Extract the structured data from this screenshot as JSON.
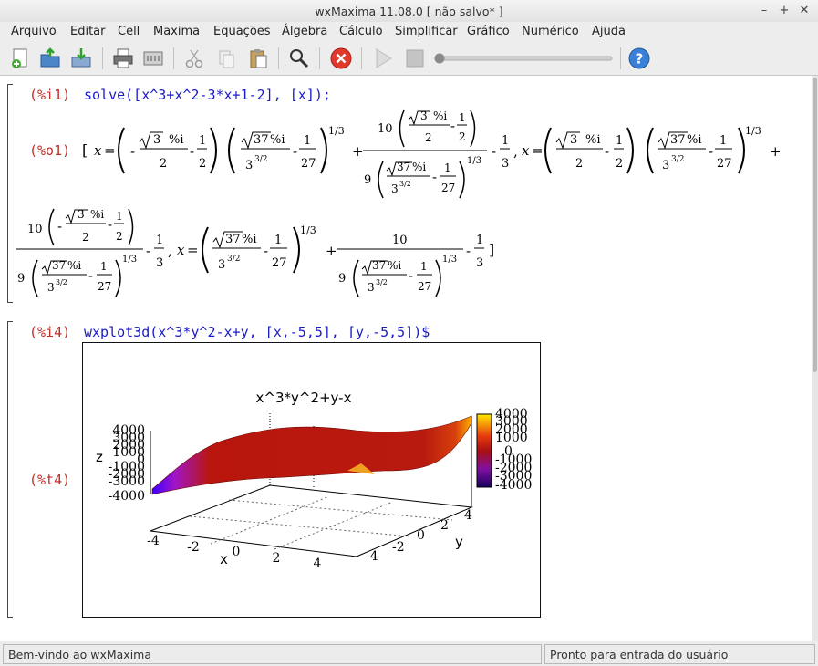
{
  "window": {
    "title": "wxMaxima 11.08.0 [ não salvo* ]",
    "minimize": "–",
    "maximize": "+",
    "close": "✕"
  },
  "menu": [
    "Arquivo",
    "Editar",
    "Cell",
    "Maxima",
    "Equações",
    "Álgebra",
    "Cálculo",
    "Simplificar",
    "Gráfico",
    "Numérico",
    "Ajuda"
  ],
  "toolbar": {
    "buttons": [
      "new-document-icon",
      "open-icon",
      "save-icon",
      "print-icon",
      "preferences-icon",
      "cut-icon",
      "copy-icon",
      "paste-icon",
      "find-icon",
      "interrupt-icon",
      "play-icon",
      "stop-icon",
      "slider",
      "help-icon"
    ],
    "accent_red": "#e03a2c",
    "accent_blue": "#3a7fd8"
  },
  "cells": [
    {
      "input_label": "(%i1)",
      "input_code": "solve([x^3+x^2-3*x+1-2], [x]);",
      "output_label": "(%o1)"
    },
    {
      "input_label": "(%i4)",
      "input_code": "wxplot3d(x^3*y^2-x+y, [x,-5,5], [y,-5,5])$",
      "output_label": "(%t4)"
    }
  ],
  "math": {
    "x_eq": "x",
    "eq": "=",
    "lbr": "[",
    "rbr": "]",
    "comma": ",",
    "minus": "-",
    "plus": "+",
    "sqrt3": "3",
    "sqrt37": "37",
    "pct_i": "%i",
    "one": "1",
    "two": "2",
    "three": "3",
    "nine": "9",
    "ten": "10",
    "twentyseven": "27",
    "exp_1_3": "1/3",
    "exp_3_2": "3/2"
  },
  "plot": {
    "title": "x^3*y^2+y-x",
    "zlabel": "z",
    "xlabel": "x",
    "ylabel": "y",
    "z_ticks": [
      "4000",
      "3000",
      "2000",
      "1000",
      "0",
      "-1000",
      "-2000",
      "-3000",
      "-4000"
    ],
    "colorbar_ticks": [
      "4000",
      "3000",
      "2000",
      "1000",
      "0",
      "-1000",
      "-2000",
      "-3000",
      "-4000"
    ],
    "x_ticks": [
      "-4",
      "-2",
      "0",
      "2",
      "4"
    ],
    "y_ticks": [
      "-4",
      "-2",
      "0",
      "2",
      "4"
    ],
    "colors": {
      "low": "#3a00ff",
      "mid": "#b81a10",
      "high": "#ffea00"
    }
  },
  "status": {
    "left": "Bem-vindo ao wxMaxima",
    "right": "Pronto para entrada do usuário"
  }
}
